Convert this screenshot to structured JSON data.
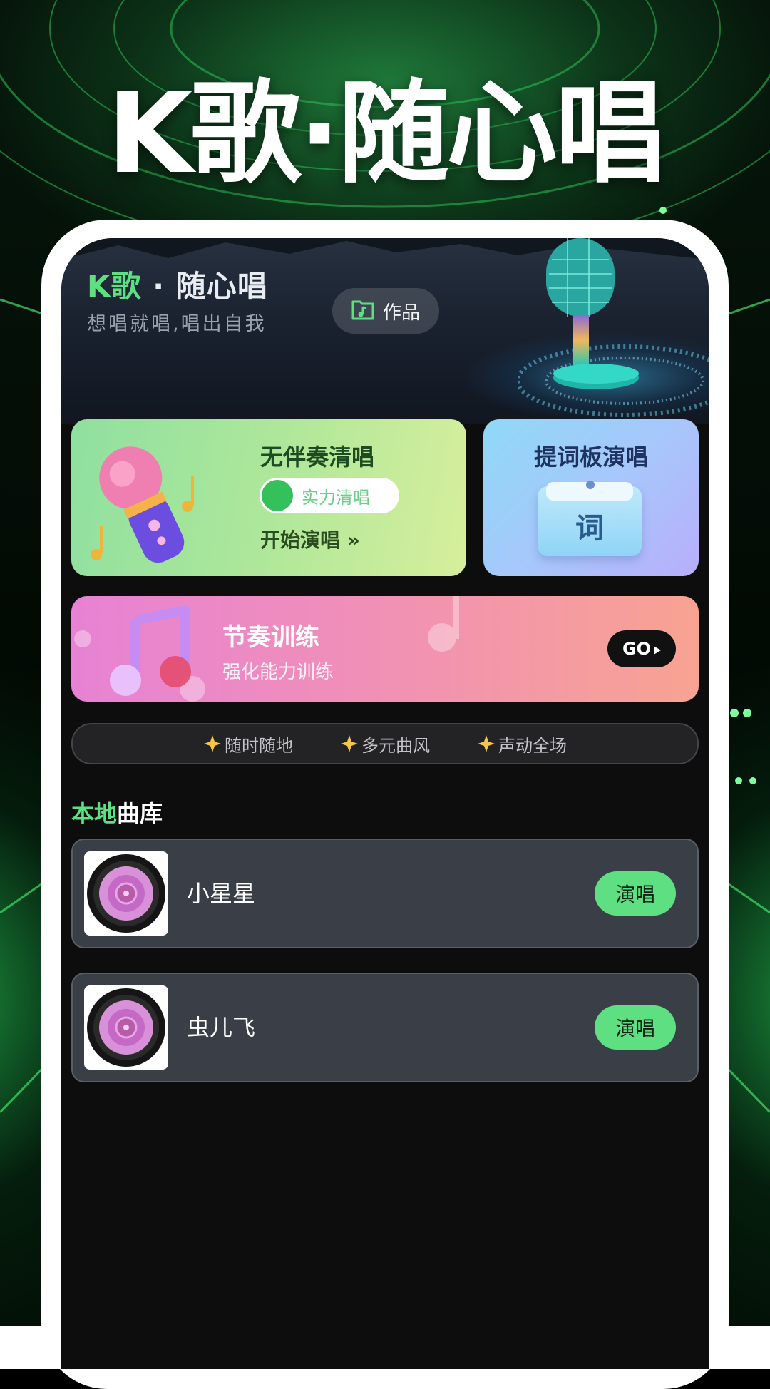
{
  "promo": {
    "title": "K歌·随心唱"
  },
  "header": {
    "app_title_k": "K歌",
    "app_title_rest": " · 随心唱",
    "subtitle": "想唱就唱,唱出自我",
    "works_button": "作品"
  },
  "cards": {
    "no_accompaniment": {
      "title": "无伴奏清唱",
      "pill": "实力清唱",
      "action": "开始演唱 »"
    },
    "teleprompter": {
      "title": "提词板演唱",
      "badge": "词"
    },
    "rhythm": {
      "title": "节奏训练",
      "subtitle": "强化能力训练",
      "go": "GO"
    }
  },
  "features": [
    "随时随地",
    "多元曲风",
    "声动全场"
  ],
  "library": {
    "title_highlight": "本地",
    "title_rest": "曲库",
    "songs": [
      {
        "name": "小星星",
        "action": "演唱"
      },
      {
        "name": "虫儿飞",
        "action": "演唱"
      }
    ]
  },
  "colors": {
    "accent_green": "#5ee082",
    "screen_bg": "#0d0d0e",
    "song_card_bg": "#3a3f47"
  },
  "icons": [
    "folder-music-icon",
    "microphone-illustration",
    "music-note-icon",
    "star-icon",
    "vinyl-disc-icon",
    "play-arrow-icon"
  ]
}
